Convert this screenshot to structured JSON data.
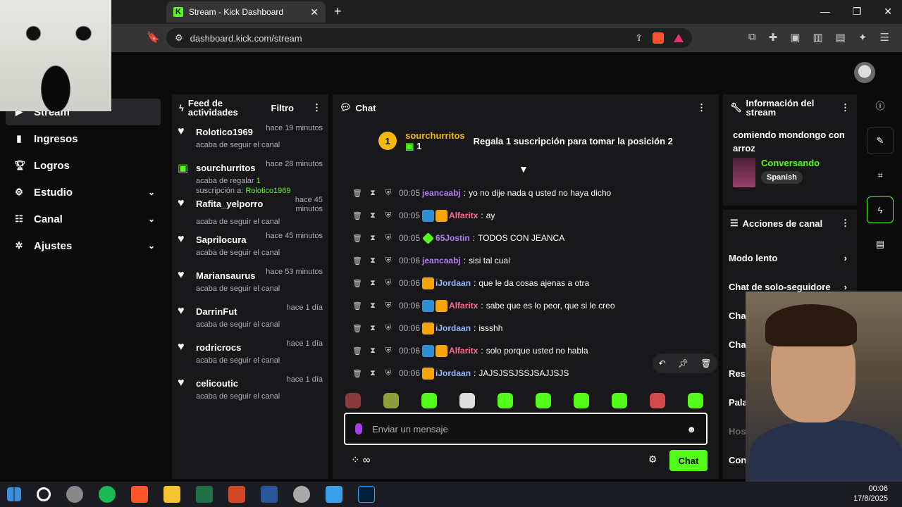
{
  "browser": {
    "tab_title": "Stream - Kick Dashboard",
    "url": "dashboard.kick.com/stream",
    "brand_color": "#53fc18"
  },
  "sidebar": {
    "items": [
      {
        "label": "Stream",
        "icon": "stream-icon"
      },
      {
        "label": "Ingresos",
        "icon": "income-icon"
      },
      {
        "label": "Logros",
        "icon": "trophy-icon"
      },
      {
        "label": "Estudio",
        "icon": "studio-icon"
      },
      {
        "label": "Canal",
        "icon": "channel-icon"
      },
      {
        "label": "Ajustes",
        "icon": "gear-icon"
      }
    ]
  },
  "feed": {
    "title": "Feed de actividades",
    "filter": "Filtro",
    "items": [
      {
        "name": "Rolotico1969",
        "time": "hace 19 minutos",
        "desc": "acaba de seguir el canal"
      },
      {
        "name": "sourchurritos",
        "time": "hace 28 minutos",
        "desc_prefix": "acaba de regalar",
        "gift_count": "1",
        "desc_mid": "suscripción a:",
        "gift_target": "Rolotico1969"
      },
      {
        "name": "Rafita_yelporro",
        "time": "hace 45 minutos",
        "desc": "acaba de seguir el canal"
      },
      {
        "name": "Saprilocura",
        "time": "hace 45 minutos",
        "desc": "acaba de seguir el canal"
      },
      {
        "name": "Mariansaurus",
        "time": "hace 53 minutos",
        "desc": "acaba de seguir el canal"
      },
      {
        "name": "DarrinFut",
        "time": "hace 1 día",
        "desc": "acaba de seguir el canal"
      },
      {
        "name": "rodricrocs",
        "time": "hace 1 día",
        "desc": "acaba de seguir el canal"
      },
      {
        "name": "celicoutic",
        "time": "hace 1 día",
        "desc": "acaba de seguir el canal"
      }
    ]
  },
  "chat": {
    "title": "Chat",
    "pinned": {
      "rank": "1",
      "user": "sourchurritos",
      "count": "1",
      "text": "Regala 1 suscripción para tomar la posición 2"
    },
    "messages": [
      {
        "time": "00:05",
        "user": "jeancaabj",
        "color": "#b37df0",
        "badges": [],
        "text": "yo no dije nada q usted no haya dicho"
      },
      {
        "time": "00:05",
        "user": "Alfaritx",
        "color": "#ff6b8b",
        "badges": [
          "blue",
          "crown"
        ],
        "text": "ay"
      },
      {
        "time": "00:05",
        "user": "65Jostin",
        "color": "#b37df0",
        "badges": [
          "gem"
        ],
        "text": "TODOS CON JEANCA"
      },
      {
        "time": "00:06",
        "user": "jeancaabj",
        "color": "#b37df0",
        "badges": [],
        "text": "sisi tal cual"
      },
      {
        "time": "00:06",
        "user": "iJordaan",
        "color": "#8fb8ff",
        "badges": [
          "crown"
        ],
        "text": "que le da cosas ajenas a otra"
      },
      {
        "time": "00:06",
        "user": "Alfaritx",
        "color": "#ff6b8b",
        "badges": [
          "blue",
          "crown"
        ],
        "text": "sabe que es lo peor, que si le creo"
      },
      {
        "time": "00:06",
        "user": "iJordaan",
        "color": "#8fb8ff",
        "badges": [
          "crown"
        ],
        "text": "issshh"
      },
      {
        "time": "00:06",
        "user": "Alfaritx",
        "color": "#ff6b8b",
        "badges": [
          "blue",
          "crown"
        ],
        "text": "solo porque usted no habla"
      },
      {
        "time": "00:06",
        "user": "iJordaan",
        "color": "#8fb8ff",
        "badges": [
          "crown"
        ],
        "text": "JAJSJSSJSSJSAJJSJS"
      }
    ],
    "placeholder": "Enviar un mensaje",
    "send_label": "Chat"
  },
  "stream_info": {
    "title": "Información del stream",
    "stream_title": "comiendo mondongo con arroz",
    "category": "Conversando",
    "language": "Spanish"
  },
  "channel_actions": {
    "title": "Acciones de canal",
    "items": [
      "Modo lento",
      "Chat de solo-seguidore",
      "Cha",
      "Cha",
      "Rest",
      "Pala",
      "Hos",
      "Con"
    ]
  },
  "taskbar": {
    "time": "00:06",
    "date": "17/8/2025"
  }
}
